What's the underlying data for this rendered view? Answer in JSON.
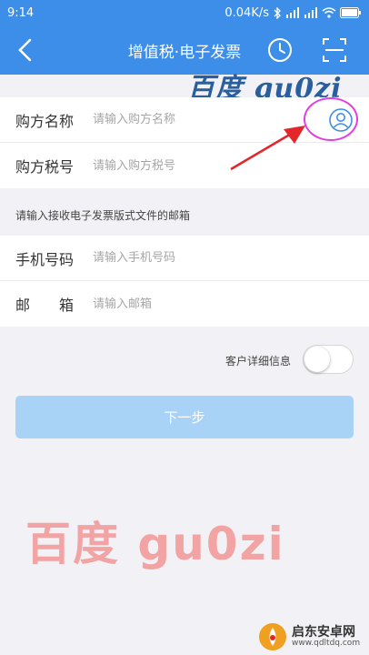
{
  "status_bar": {
    "time": "9:14",
    "net_speed": "0.04K/s"
  },
  "nav": {
    "title": "增值税·电子发票"
  },
  "watermark_top": "百度 gu0zi",
  "form": {
    "buyer_name": {
      "label": "购方名称",
      "placeholder": "请输入购方名称"
    },
    "buyer_tax": {
      "label": "购方税号",
      "placeholder": "请输入购方税号"
    },
    "email_hint": "请输入接收电子发票版式文件的邮箱",
    "phone": {
      "label": "手机号码",
      "placeholder": "请输入手机号码"
    },
    "email": {
      "label": "邮　　箱",
      "placeholder": "请输入邮箱"
    }
  },
  "customer_detail": {
    "label": "客户详细信息",
    "enabled": false
  },
  "next_button": "下一步",
  "watermark_big": "百度  gu0zi",
  "brand": {
    "name": "启东安卓网",
    "url": "www.qdltdq.com"
  },
  "colors": {
    "nav": "#3d8ee8",
    "button": "#a9d3f6",
    "annotation": "#e23fe0",
    "arrow": "#e2262a"
  }
}
